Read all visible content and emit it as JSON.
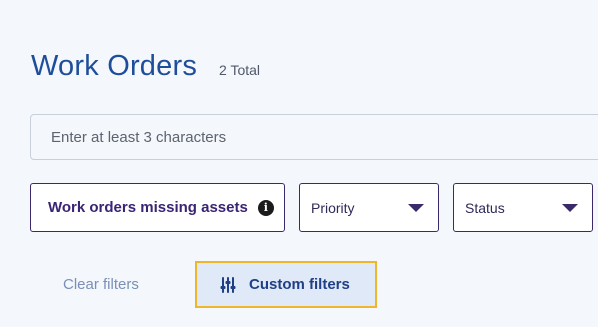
{
  "header": {
    "title": "Work Orders",
    "total": "2 Total"
  },
  "search": {
    "placeholder": "Enter at least 3 characters"
  },
  "filters": {
    "missing_assets_label": "Work orders missing assets",
    "info_icon": "info-circle",
    "priority_label": "Priority",
    "status_label": "Status"
  },
  "actions": {
    "clear_label": "Clear filters",
    "custom_label": "Custom filters",
    "custom_icon": "sliders"
  },
  "colors": {
    "title": "#1e4e9a",
    "highlight_border": "#f0b62a",
    "custom_bg": "#dfe9f7"
  }
}
